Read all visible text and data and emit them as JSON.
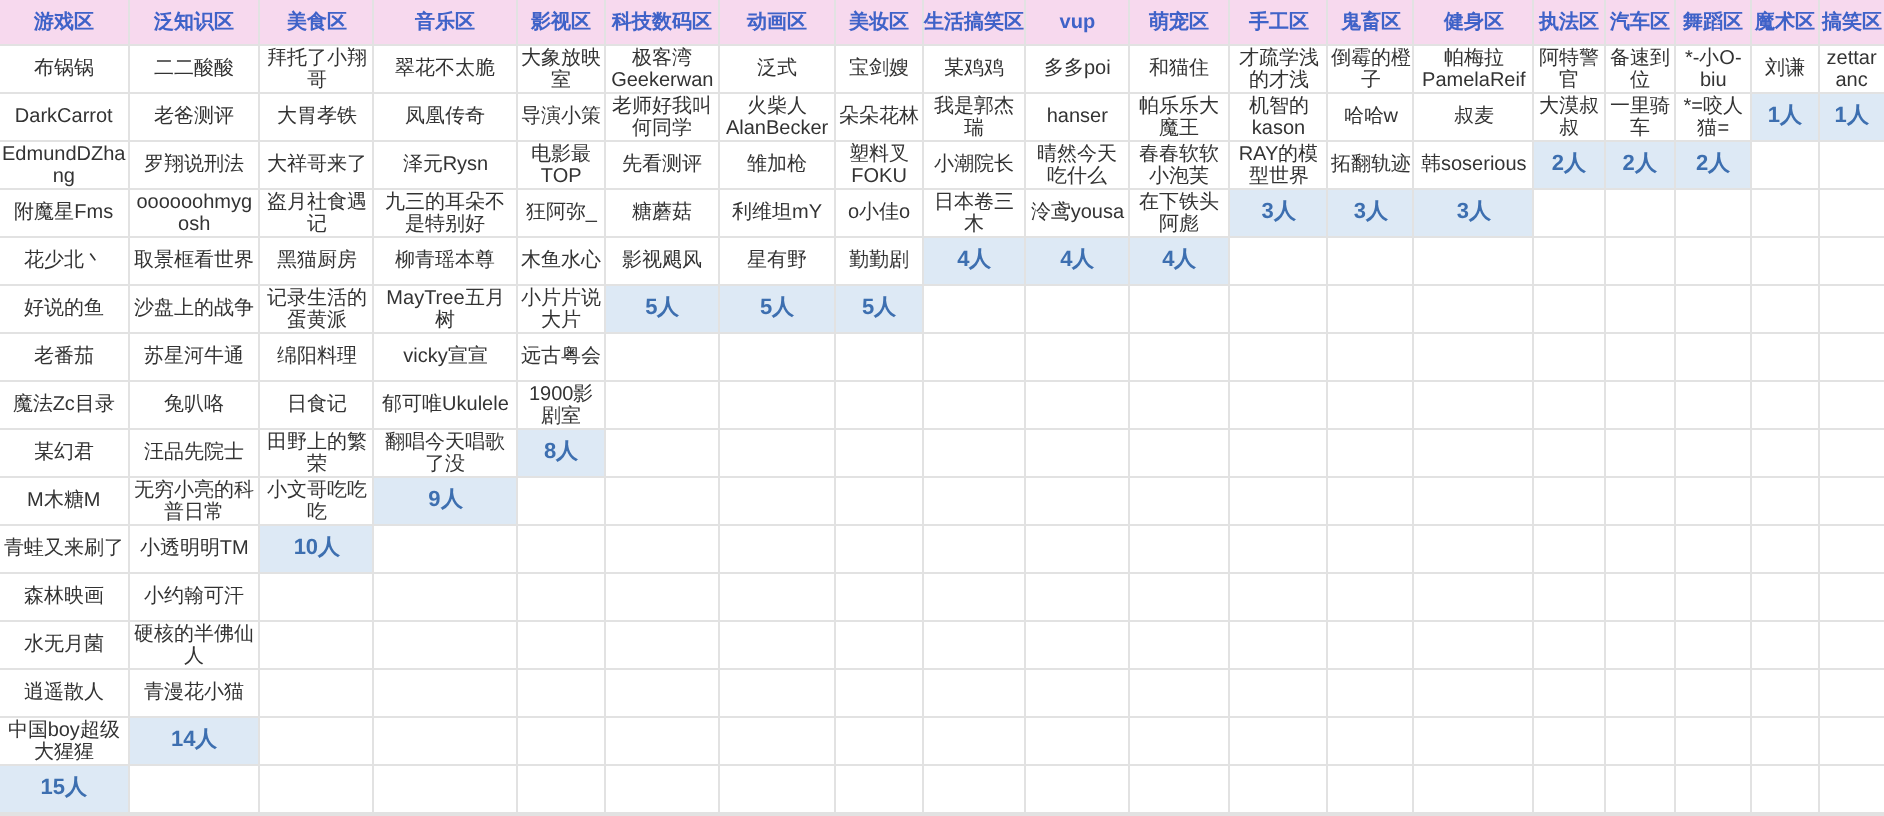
{
  "table": {
    "columns": [
      {
        "header": "游戏区",
        "names": [
          "布锅锅",
          "DarkCarrot",
          "EdmundDZhang",
          "附魔星Fms",
          "花少北丶",
          "好说的鱼",
          "老番茄",
          "魔法Zc目录",
          "某幻君",
          "M木糖M",
          "青蛙又来刷了",
          "森林映画",
          "水无月菌",
          "逍遥散人",
          "中国boy超级大猩猩"
        ],
        "count": "15人"
      },
      {
        "header": "泛知识区",
        "names": [
          "二二酸酸",
          "老爸测评",
          "罗翔说刑法",
          "oooooohmygosh",
          "取景框看世界",
          "沙盘上的战争",
          "苏星河牛通",
          "兔叭咯",
          "汪品先院士",
          "无穷小亮的科普日常",
          "小透明明TM",
          "小约翰可汗",
          "硬核的半佛仙人",
          "青漫花小猫"
        ],
        "count": "14人"
      },
      {
        "header": "美食区",
        "names": [
          "拜托了小翔哥",
          "大胃孝铁",
          "大祥哥来了",
          "盗月社食遇记",
          "黑猫厨房",
          "记录生活的蛋黄派",
          "绵阳料理",
          "日食记",
          "田野上的繁荣",
          "小文哥吃吃吃"
        ],
        "count": "10人"
      },
      {
        "header": "音乐区",
        "names": [
          "翠花不太脆",
          "凤凰传奇",
          "泽元Rysn",
          "九三的耳朵不是特别好",
          "柳青瑶本尊",
          "MayTree五月树",
          "vicky宣宣",
          "郁可唯Ukulele",
          "翻唱今天唱歌了没"
        ],
        "count": "9人"
      },
      {
        "header": "影视区",
        "names": [
          "大象放映室",
          "导演小策",
          "电影最TOP",
          "狂阿弥_",
          "木鱼水心",
          "小片片说大片",
          "远古粤会",
          "1900影剧室"
        ],
        "count": "8人"
      },
      {
        "header": "科技数码区",
        "names": [
          "极客湾Geekerwan",
          "老师好我叫何同学",
          "先看测评",
          "糖蘑菇",
          "影视飓风"
        ],
        "count": "5人"
      },
      {
        "header": "动画区",
        "names": [
          "泛式",
          "火柴人AlanBecker",
          "雏加枪",
          "利维坦mY",
          "星有野"
        ],
        "count": "5人"
      },
      {
        "header": "美妆区",
        "names": [
          "宝剑嫂",
          "朵朵花林",
          "塑料叉FOKU",
          "o小佳o",
          "勤勤剧"
        ],
        "count": "5人"
      },
      {
        "header": "生活搞笑区",
        "names": [
          "某鸡鸡",
          "我是郭杰瑞",
          "小潮院长",
          "日本卷三木"
        ],
        "count": "4人"
      },
      {
        "header": "vup",
        "names": [
          "多多poi",
          "hanser",
          "晴然今天吃什么",
          "泠鸢yousa"
        ],
        "count": "4人"
      },
      {
        "header": "萌宠区",
        "names": [
          "和猫住",
          "帕乐乐大魔王",
          "春春软软小泡芙",
          "在下铁头阿彪"
        ],
        "count": "4人"
      },
      {
        "header": "手工区",
        "names": [
          "才疏学浅的才浅",
          "机智的kason",
          "RAY的模型世界"
        ],
        "count": "3人"
      },
      {
        "header": "鬼畜区",
        "names": [
          "倒霉的橙子",
          "哈哈w",
          "拓翻轨迹"
        ],
        "count": "3人"
      },
      {
        "header": "健身区",
        "names": [
          "帕梅拉PamelaReif",
          "叔麦",
          "韩soserious"
        ],
        "count": "3人"
      },
      {
        "header": "执法区",
        "names": [
          "阿特警官",
          "大漠叔叔"
        ],
        "count": "2人"
      },
      {
        "header": "汽车区",
        "names": [
          "备速到位",
          "一里骑车"
        ],
        "count": "2人"
      },
      {
        "header": "舞蹈区",
        "names": [
          "*-小O-biu",
          "*=咬人猫="
        ],
        "count": "2人"
      },
      {
        "header": "魔术区",
        "names": [
          "刘谦"
        ],
        "count": "1人"
      },
      {
        "header": "搞笑区",
        "names": [
          "zettaranc"
        ],
        "count": "1人"
      }
    ]
  }
}
